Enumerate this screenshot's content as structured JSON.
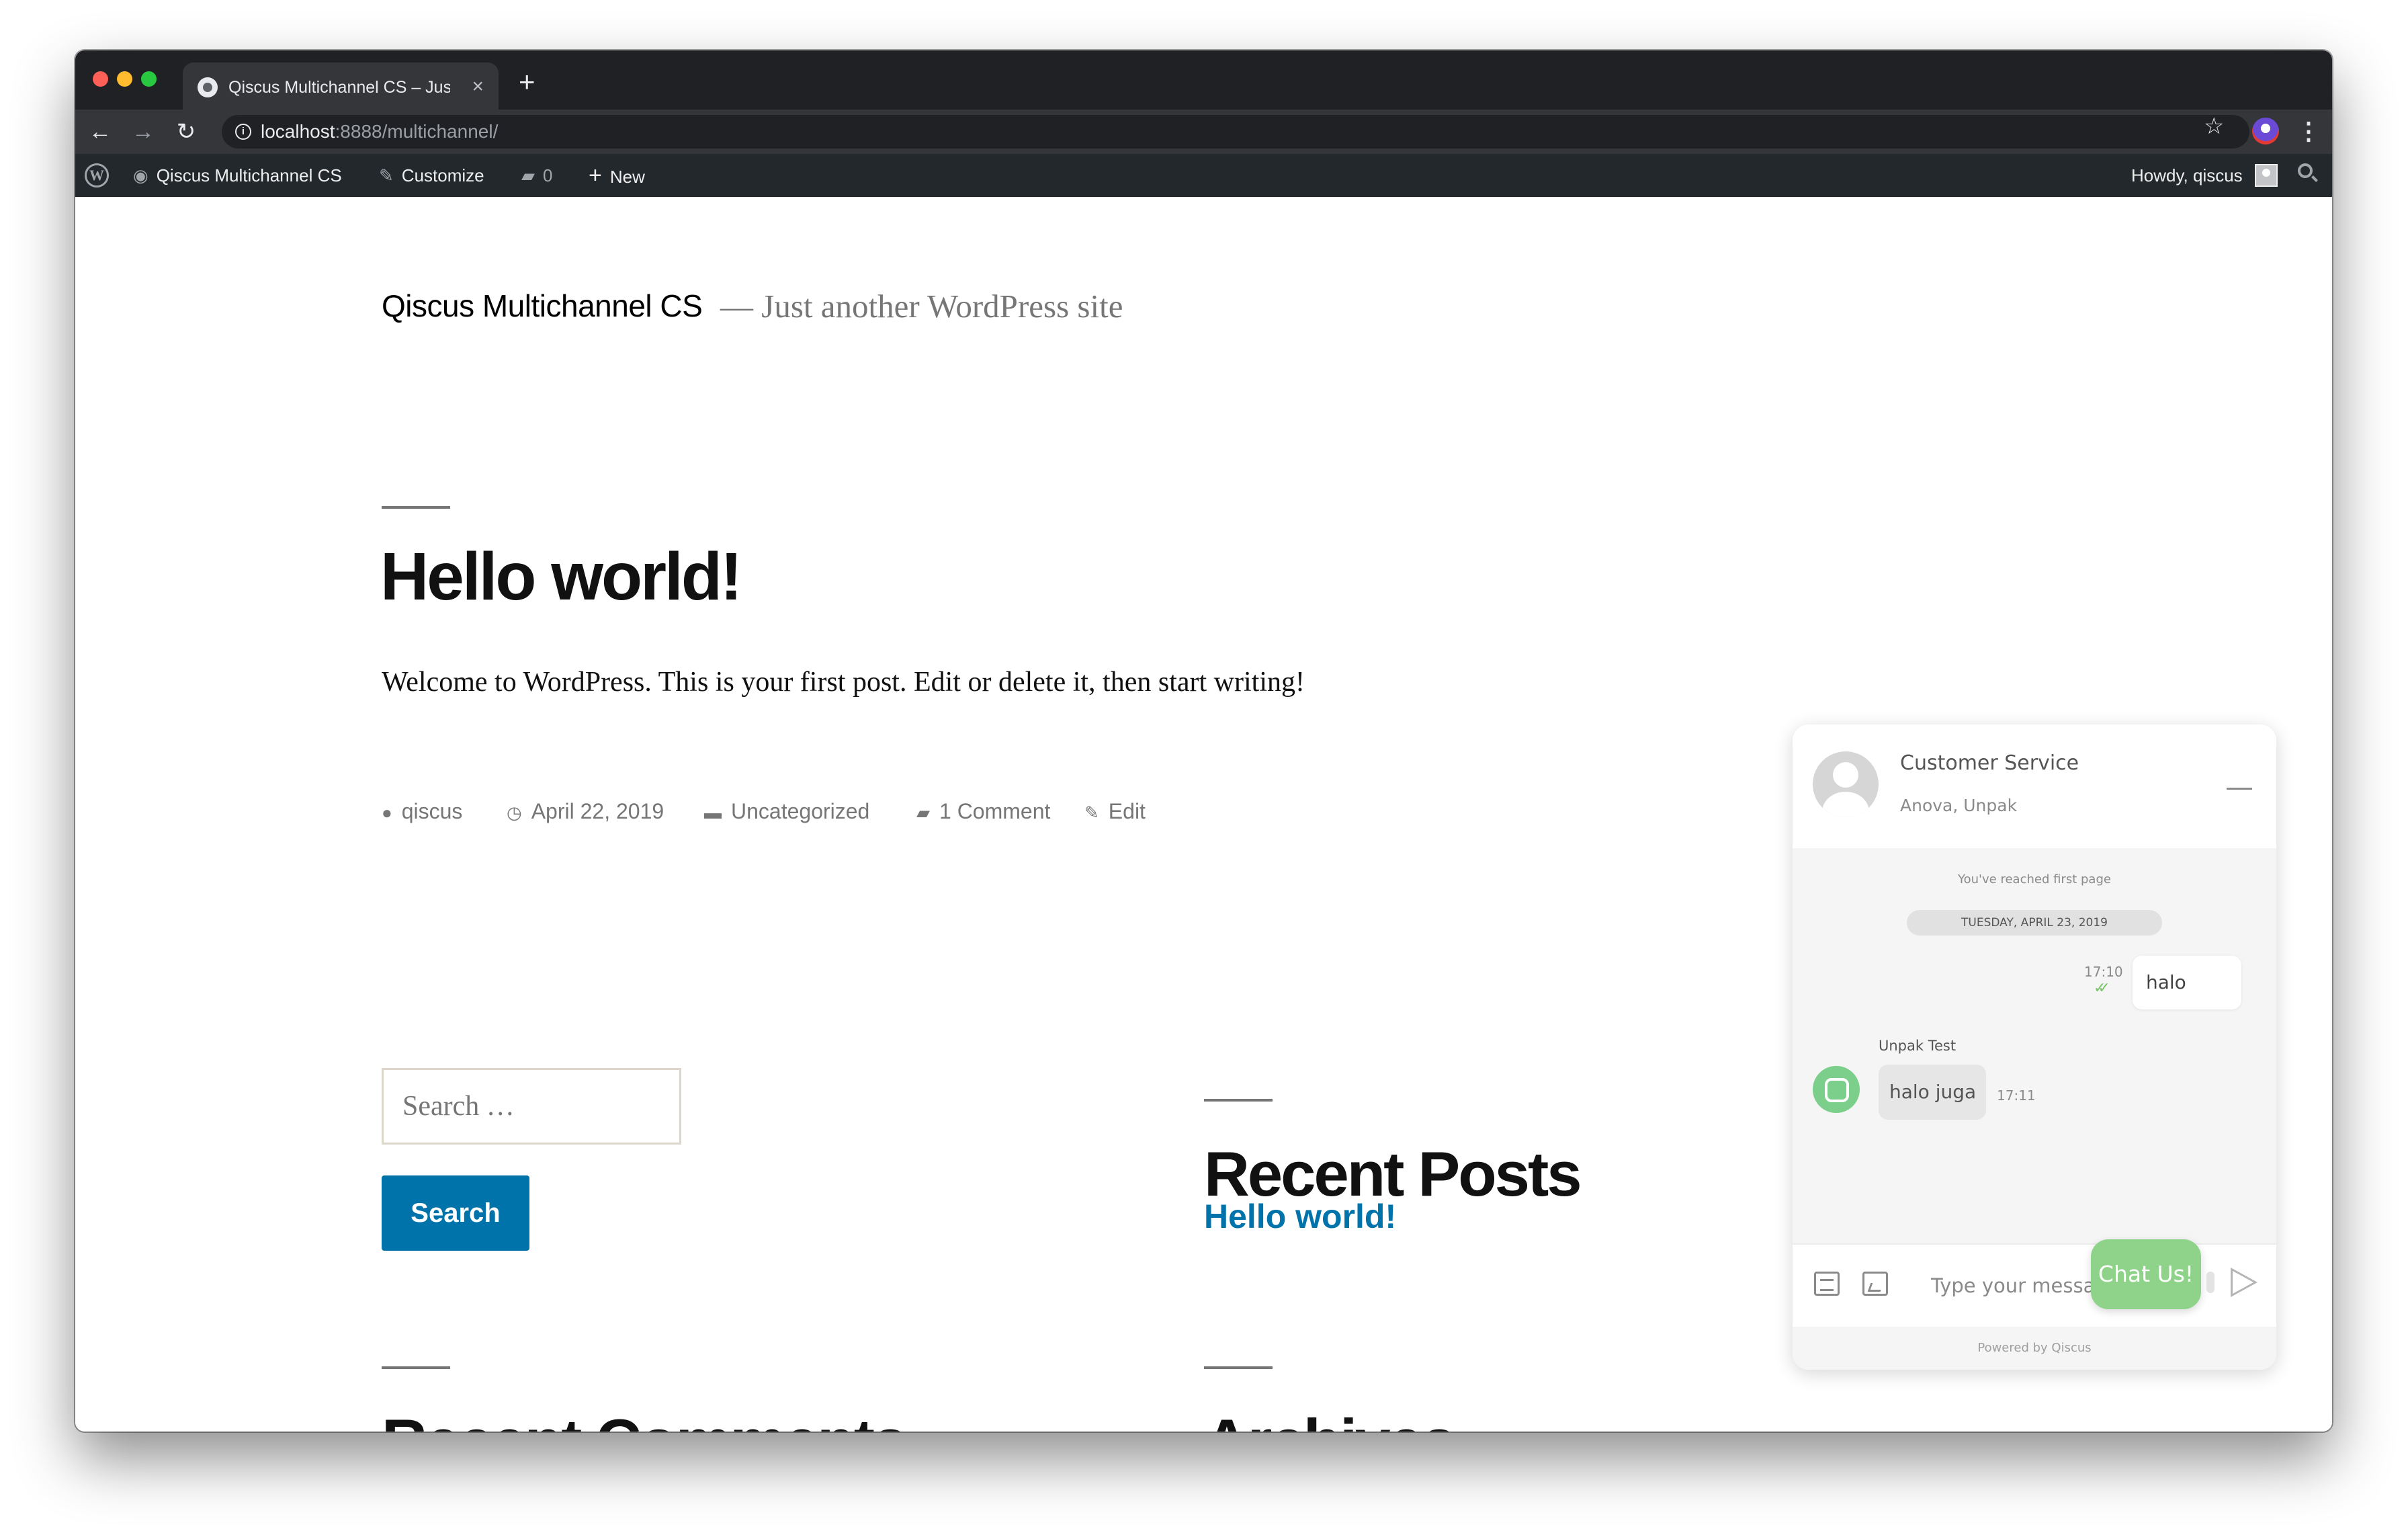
{
  "browser": {
    "tab_title": "Qiscus Multichannel CS – Just another WordPress site",
    "tab_close": "×",
    "new_tab": "+",
    "url_host": "localhost",
    "url_path": ":8888/multichannel/",
    "traffic_lights": [
      "#fe5f57",
      "#febc2e",
      "#28c840"
    ]
  },
  "adminbar": {
    "site_name": "Qiscus Multichannel CS",
    "customize": "Customize",
    "comments_count": "0",
    "new": "New",
    "howdy": "Howdy, qiscus",
    "wp_logo_letter": "W"
  },
  "site": {
    "title": "Qiscus Multichannel CS",
    "description": "— Just another WordPress site"
  },
  "post": {
    "title": "Hello world!",
    "body": "Welcome to WordPress. This is your first post. Edit or delete it, then start writing!",
    "meta": {
      "author": "qiscus",
      "date": "April 22, 2019",
      "category": "Uncategorized",
      "comments": "1 Comment",
      "edit": "Edit"
    }
  },
  "widgets": {
    "search_placeholder": "Search …",
    "search_button": "Search",
    "recent_posts_title": "Recent Posts",
    "recent_post_link": "Hello world!",
    "recent_comments_title": "Recent Comments",
    "archives_title": "Archives"
  },
  "chat": {
    "agent_name": "Customer Service",
    "agent_sub": "Anova, Unpak",
    "first_page": "You've reached first page",
    "date_label": "TUESDAY, APRIL 23, 2019",
    "outgoing": {
      "text": "halo",
      "time": "17:10"
    },
    "incoming": {
      "sender": "Unpak Test",
      "text": "halo juga",
      "time": "17:11"
    },
    "input_placeholder": "Type your message",
    "powered_by": "Powered by Qiscus",
    "launcher": "Chat Us!"
  },
  "colors": {
    "wp_blue": "#0073aa",
    "adminbar_bg": "#23282d",
    "chat_green": "#8fd38a"
  }
}
